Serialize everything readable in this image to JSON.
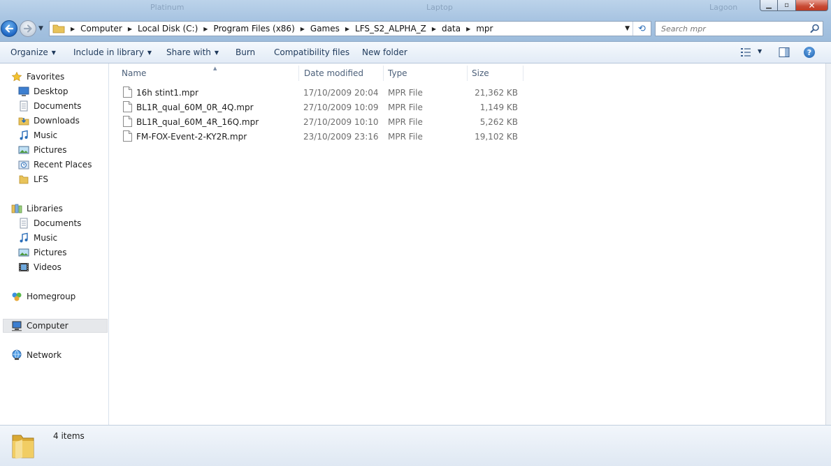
{
  "window": {
    "ghost_titles": [
      "Platinum",
      "Laptop",
      "Lagoon"
    ],
    "minimize_glyph": "▁",
    "maximize_glyph": "▫",
    "close_glyph": "✕"
  },
  "address_bar": {
    "crumbs": [
      "Computer",
      "Local Disk (C:)",
      "Program Files (x86)",
      "Games",
      "LFS_S2_ALPHA_Z",
      "data",
      "mpr"
    ]
  },
  "search": {
    "placeholder": "Search mpr"
  },
  "toolbar": {
    "organize": "Organize",
    "include_in_library": "Include in library",
    "share_with": "Share with",
    "burn": "Burn",
    "compatibility_files": "Compatibility files",
    "new_folder": "New folder",
    "help": "?"
  },
  "nav": {
    "favorites": {
      "label": "Favorites",
      "items": [
        "Desktop",
        "Documents",
        "Downloads",
        "Music",
        "Pictures",
        "Recent Places",
        "LFS"
      ]
    },
    "libraries": {
      "label": "Libraries",
      "items": [
        "Documents",
        "Music",
        "Pictures",
        "Videos"
      ]
    },
    "homegroup": "Homegroup",
    "computer": "Computer",
    "network": "Network"
  },
  "columns": {
    "name": "Name",
    "date_modified": "Date modified",
    "type": "Type",
    "size": "Size"
  },
  "files": [
    {
      "name": "16h stint1.mpr",
      "date": "17/10/2009 20:04",
      "type": "MPR File",
      "size": "21,362 KB"
    },
    {
      "name": "BL1R_qual_60M_0R_4Q.mpr",
      "date": "27/10/2009 10:09",
      "type": "MPR File",
      "size": "1,149 KB"
    },
    {
      "name": "BL1R_qual_60M_4R_16Q.mpr",
      "date": "27/10/2009 10:10",
      "type": "MPR File",
      "size": "5,262 KB"
    },
    {
      "name": "FM-FOX-Event-2-KY2R.mpr",
      "date": "23/10/2009 23:16",
      "type": "MPR File",
      "size": "19,102 KB"
    }
  ],
  "status": {
    "item_count": "4 items"
  },
  "colors": {
    "accent": "#1e395b",
    "selection": "#e6e8eb"
  }
}
